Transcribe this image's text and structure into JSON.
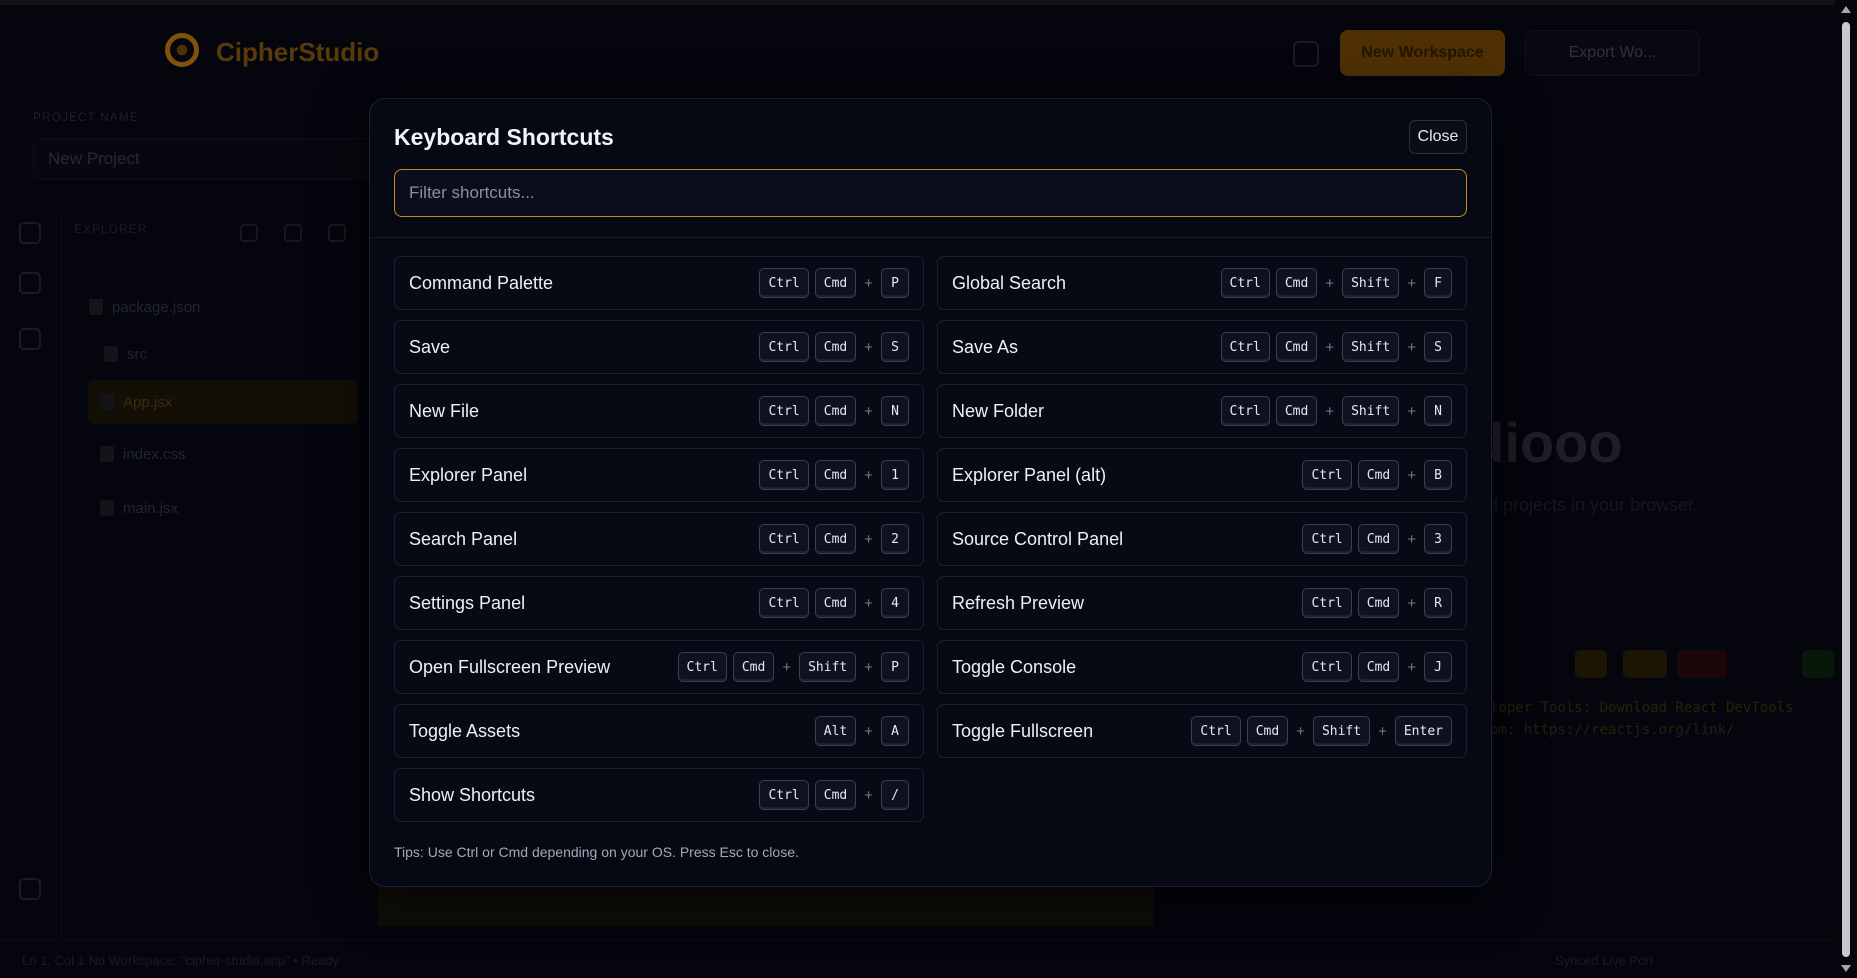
{
  "background": {
    "brand": "CipherStudio",
    "header_primary_button": "New Workspace",
    "header_secondary_button": "Export Wo...",
    "project_label": "PROJECT NAME",
    "project_name": "New Project",
    "explorer_title": "EXPLORER",
    "tree": [
      "package.json",
      "src",
      "App.jsx",
      "index.css",
      "main.jsx"
    ],
    "preview_title": "Studiooo",
    "preview_subtitle": "ild projects in your browser.",
    "console_lines": [
      "loper Tools: Download React DevTools",
      "om: https://reactjs.org/link/"
    ],
    "status_left": "Ln 1, Col 1   No Workspace: \"cipher-studio.app\" • Ready",
    "status_right": "Synced   Live   Port"
  },
  "modal": {
    "title": "Keyboard Shortcuts",
    "close_label": "Close",
    "filter_placeholder": "Filter shortcuts...",
    "tips": "Tips: Use Ctrl or Cmd depending on your OS. Press Esc to close.",
    "shortcuts": [
      {
        "label": "Command Palette",
        "keys": [
          "Ctrl",
          "Cmd",
          "P"
        ]
      },
      {
        "label": "Global Search",
        "keys": [
          "Ctrl",
          "Cmd",
          "Shift",
          "F"
        ]
      },
      {
        "label": "Save",
        "keys": [
          "Ctrl",
          "Cmd",
          "S"
        ]
      },
      {
        "label": "Save As",
        "keys": [
          "Ctrl",
          "Cmd",
          "Shift",
          "S"
        ]
      },
      {
        "label": "New File",
        "keys": [
          "Ctrl",
          "Cmd",
          "N"
        ]
      },
      {
        "label": "New Folder",
        "keys": [
          "Ctrl",
          "Cmd",
          "Shift",
          "N"
        ]
      },
      {
        "label": "Explorer Panel",
        "keys": [
          "Ctrl",
          "Cmd",
          "1"
        ]
      },
      {
        "label": "Explorer Panel (alt)",
        "keys": [
          "Ctrl",
          "Cmd",
          "B"
        ]
      },
      {
        "label": "Search Panel",
        "keys": [
          "Ctrl",
          "Cmd",
          "2"
        ]
      },
      {
        "label": "Source Control Panel",
        "keys": [
          "Ctrl",
          "Cmd",
          "3"
        ]
      },
      {
        "label": "Settings Panel",
        "keys": [
          "Ctrl",
          "Cmd",
          "4"
        ]
      },
      {
        "label": "Refresh Preview",
        "keys": [
          "Ctrl",
          "Cmd",
          "R"
        ]
      },
      {
        "label": "Open Fullscreen Preview",
        "keys": [
          "Ctrl",
          "Cmd",
          "Shift",
          "P"
        ]
      },
      {
        "label": "Toggle Console",
        "keys": [
          "Ctrl",
          "Cmd",
          "J"
        ]
      },
      {
        "label": "Toggle Assets",
        "keys": [
          "Alt",
          "A"
        ]
      },
      {
        "label": "Toggle Fullscreen",
        "keys": [
          "Ctrl",
          "Cmd",
          "Shift",
          "Enter"
        ]
      },
      {
        "label": "Show Shortcuts",
        "keys": [
          "Ctrl",
          "Cmd",
          "/"
        ]
      }
    ]
  },
  "colors": {
    "accent": "#c78a1e",
    "modal_bg": "#060914",
    "row_border": "#1b2030"
  }
}
